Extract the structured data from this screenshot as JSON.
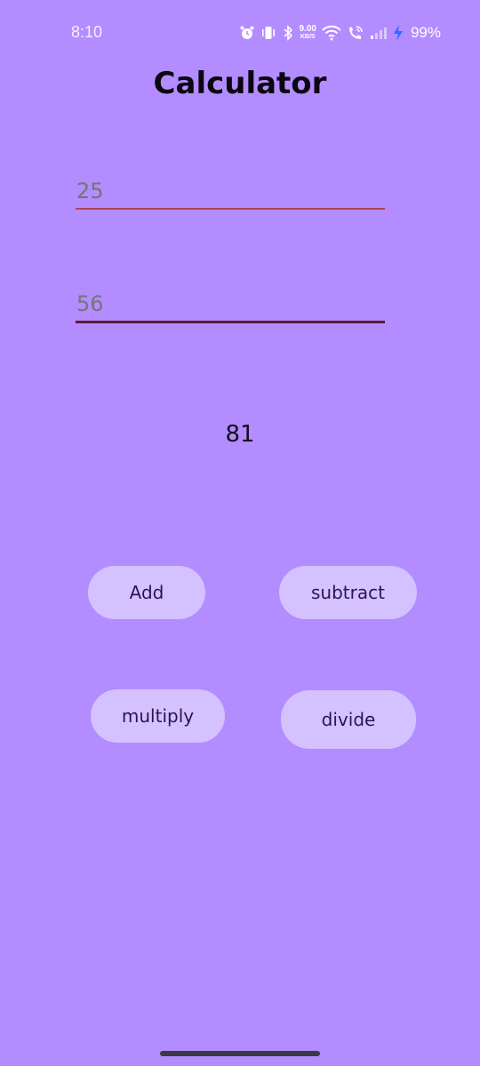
{
  "status_bar": {
    "time": "8:10",
    "net_speed_value": "9.00",
    "net_speed_unit": "KB/S",
    "battery": "99%",
    "icons": [
      "alarm-icon",
      "vibrate-icon",
      "bluetooth-icon",
      "net-speed",
      "wifi-icon",
      "wifi-call-icon",
      "signal-icon",
      "charging-icon"
    ]
  },
  "app": {
    "title": "Calculator"
  },
  "inputs": {
    "first_value": "25",
    "second_value": "56"
  },
  "result": "81",
  "buttons": {
    "add": "Add",
    "subtract": "subtract",
    "multiply": "multiply",
    "divide": "divide"
  },
  "colors": {
    "background": "#b38cff",
    "button": "#d4c1ff",
    "button_text": "#2c1450",
    "underline_1": "#b2405e",
    "underline_2": "#5a1a3a"
  }
}
